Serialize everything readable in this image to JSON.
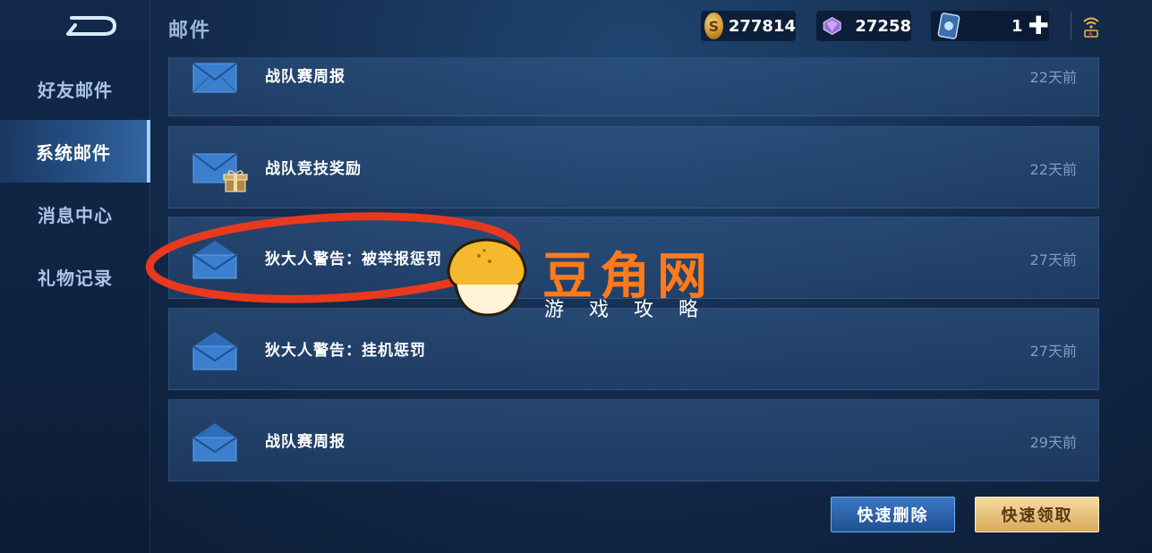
{
  "header": {
    "title": "邮件",
    "gold": "277814",
    "diamonds": "27258",
    "tickets": "1"
  },
  "sidebar": {
    "items": [
      {
        "label": "好友邮件",
        "active": false
      },
      {
        "label": "系统邮件",
        "active": true
      },
      {
        "label": "消息中心",
        "active": false
      },
      {
        "label": "礼物记录",
        "active": false
      }
    ]
  },
  "mails": [
    {
      "title": "战队赛周报",
      "time": "22天前",
      "icon": "envelope-closed"
    },
    {
      "title": "战队竞技奖励",
      "time": "22天前",
      "icon": "envelope-gift"
    },
    {
      "title": "狄大人警告：被举报惩罚",
      "time": "27天前",
      "icon": "envelope-open"
    },
    {
      "title": "狄大人警告：挂机惩罚",
      "time": "27天前",
      "icon": "envelope-open"
    },
    {
      "title": "战队赛周报",
      "time": "29天前",
      "icon": "envelope-open"
    }
  ],
  "buttons": {
    "delete_label": "快速删除",
    "claim_label": "快速领取"
  },
  "watermark": {
    "title": "豆角网",
    "subtitle": "游戏攻略"
  },
  "colors": {
    "highlight_circle": "#e8391f",
    "watermark": "#ff7a1a",
    "claim_button": "#e6c07a",
    "delete_button": "#2a63ab"
  }
}
